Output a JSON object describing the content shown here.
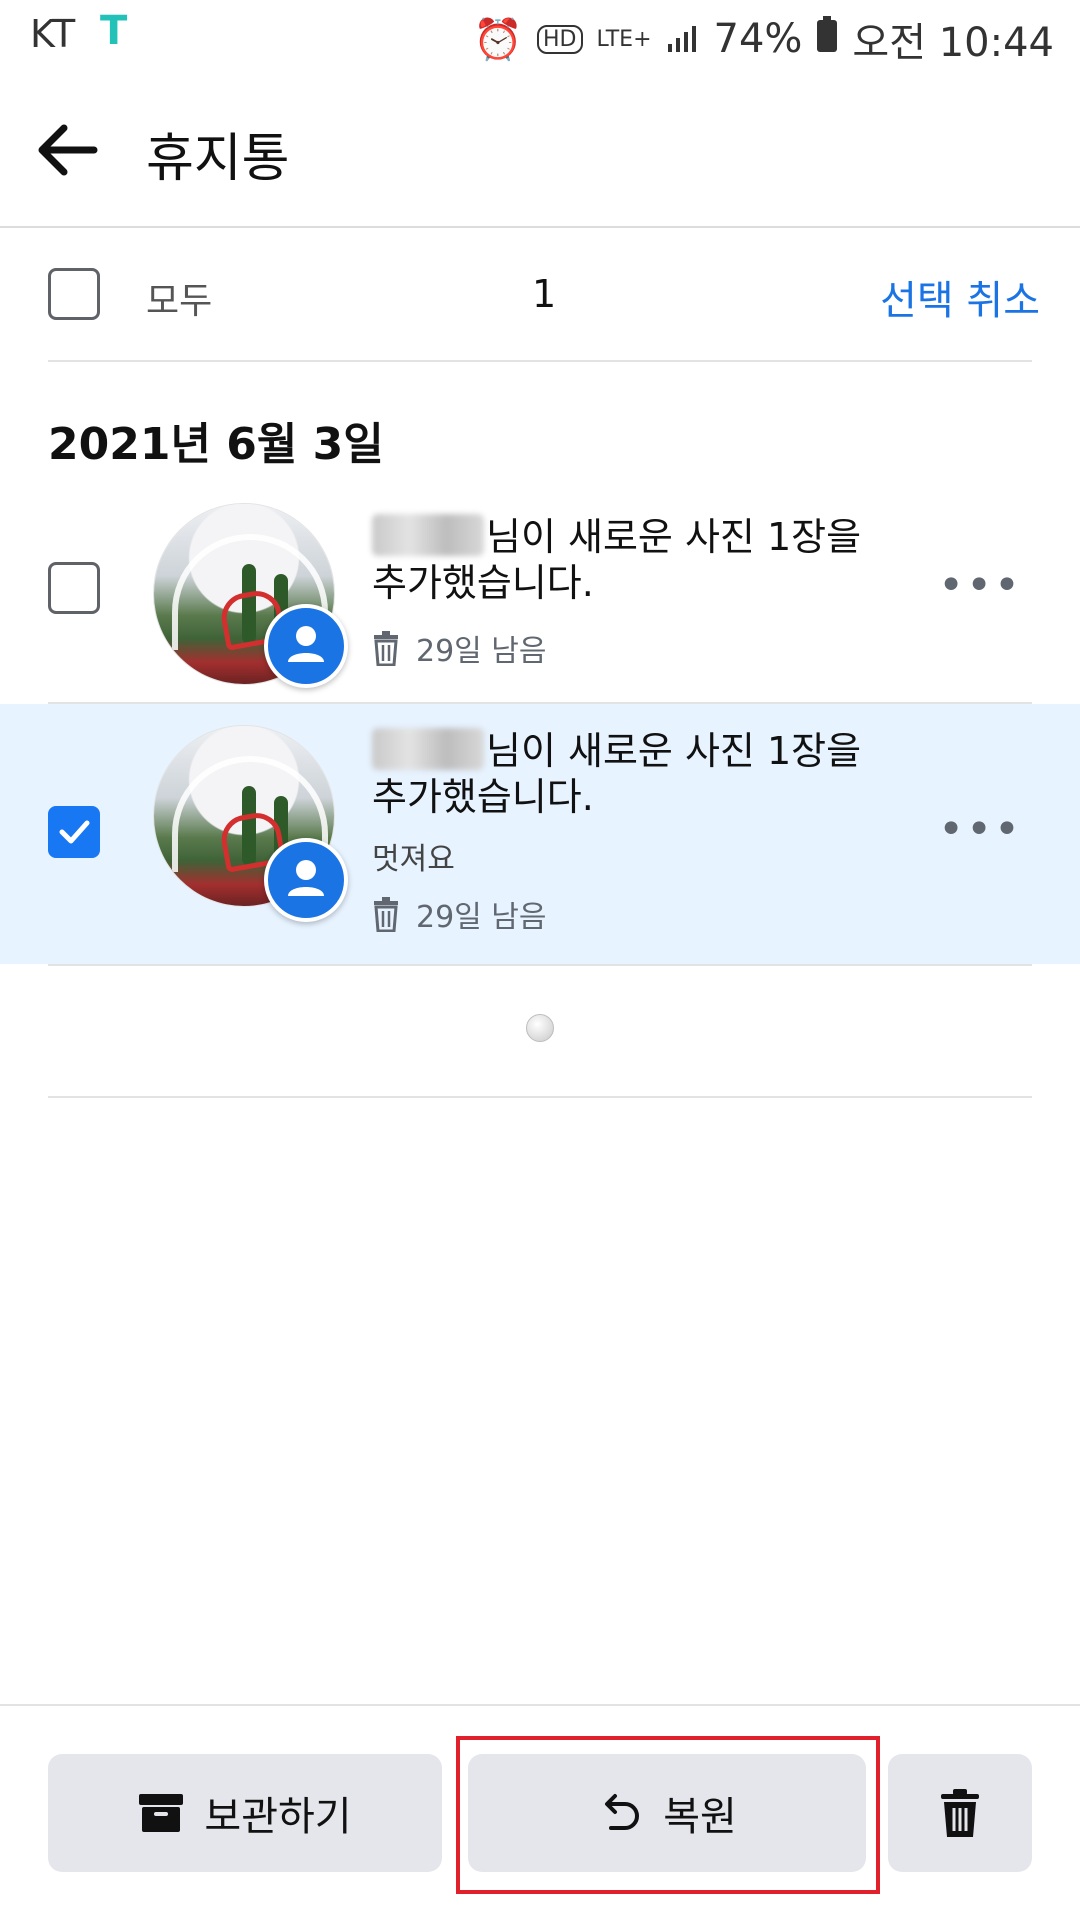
{
  "status_bar": {
    "carrier": "KT",
    "carrier_icon": "T",
    "network": "LTE+",
    "battery": "74%",
    "time": "오전 10:44"
  },
  "header": {
    "title": "휴지통"
  },
  "selection": {
    "all_label": "모두",
    "count": "1",
    "deselect_label": "선택 취소"
  },
  "date_header": "2021년 6월 3일",
  "items": [
    {
      "text_line1": "님이 새로운 사진 1장을",
      "text_line2": "추가했습니다.",
      "comment": "",
      "days_left": "29일 남음",
      "selected": false
    },
    {
      "text_line1": "님이 새로운 사진 1장을",
      "text_line2": "추가했습니다.",
      "comment": "멋져요",
      "days_left": "29일 남음",
      "selected": true
    }
  ],
  "bottom_bar": {
    "archive_label": "보관하기",
    "restore_label": "복원"
  },
  "colors": {
    "accent": "#1b74e4",
    "selected_bg": "#e7f3ff",
    "highlight": "#e0202a"
  }
}
